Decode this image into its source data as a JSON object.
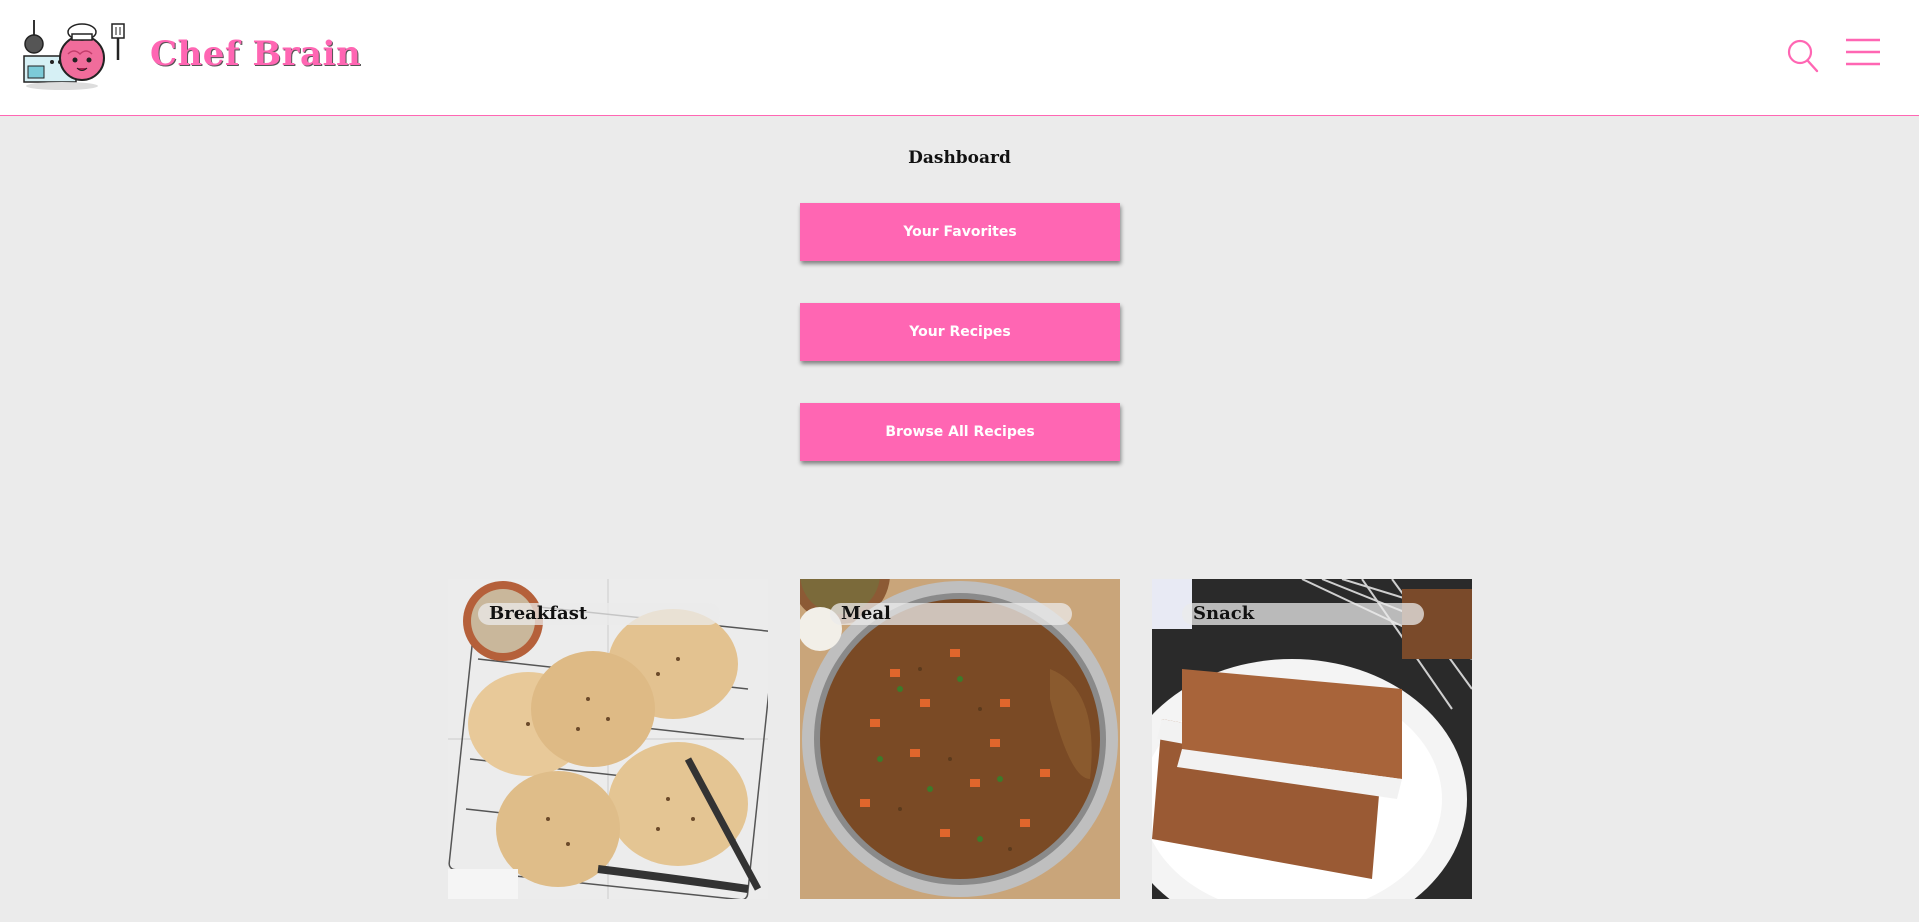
{
  "header": {
    "brand": "Chef Brain",
    "logo_icon": "chef-brain-logo",
    "search_icon": "search-icon",
    "menu_icon": "hamburger-menu-icon",
    "accent_color": "#ff66b3"
  },
  "dashboard": {
    "title": "Dashboard",
    "buttons": [
      {
        "label": "Your Favorites"
      },
      {
        "label": "Your Recipes"
      },
      {
        "label": "Browse All Recipes"
      }
    ]
  },
  "categories": [
    {
      "label": "Breakfast",
      "image": "flatbread-on-rack-photo"
    },
    {
      "label": "Meal",
      "image": "lentil-stew-pot-photo"
    },
    {
      "label": "Snack",
      "image": "glazed-loaf-slices-photo"
    }
  ]
}
